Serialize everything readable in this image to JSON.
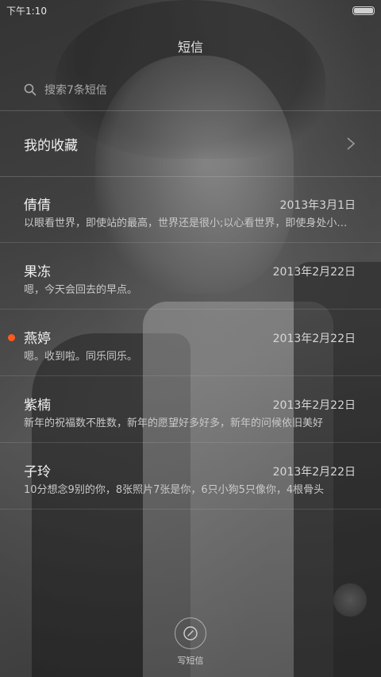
{
  "status_bar": {
    "time": "下午1:10"
  },
  "header": {
    "title": "短信"
  },
  "search": {
    "placeholder": "搜索7条短信"
  },
  "favorites": {
    "label": "我的收藏"
  },
  "conversations": [
    {
      "name": "倩倩",
      "date": "2013年3月1日",
      "preview": "以眼看世界，即使站的最高，世界还是很小;以心看世界，即使身处小屋，世界也是很大",
      "unread": false
    },
    {
      "name": "果冻",
      "date": "2013年2月22日",
      "preview": "嗯，今天会回去的早点。",
      "unread": false
    },
    {
      "name": "燕婷",
      "date": "2013年2月22日",
      "preview": "嗯。收到啦。同乐同乐。",
      "unread": true
    },
    {
      "name": "紫楠",
      "date": "2013年2月22日",
      "preview": "新年的祝福数不胜数，新年的愿望好多好多，新年的问候依旧美好",
      "unread": false
    },
    {
      "name": "子玲",
      "date": "2013年2月22日",
      "preview": "10分想念9别的你，8张照片7张是你，6只小狗5只像你，4根骨头",
      "unread": false
    }
  ],
  "compose": {
    "label": "写短信"
  },
  "colors": {
    "unread_dot": "#ff5a1f"
  }
}
